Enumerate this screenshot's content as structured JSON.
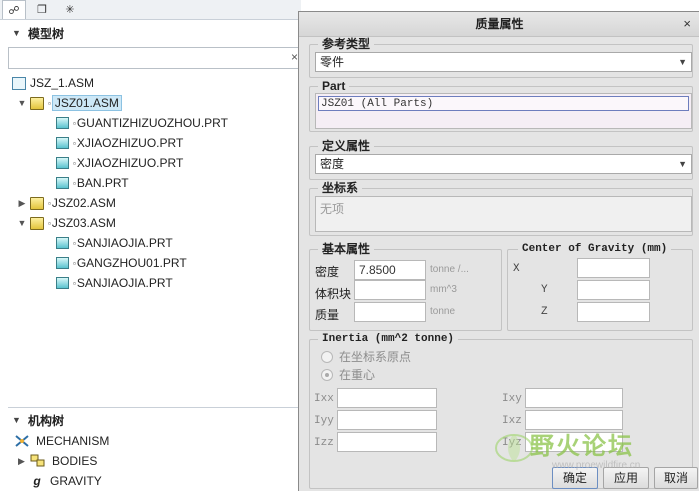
{
  "left_tabs": [
    "☍",
    "❐",
    "✳"
  ],
  "model_tree": {
    "header": "模型树",
    "search": {
      "value": "",
      "clear_glyph": "×"
    },
    "nodes": [
      {
        "label": "JSZ_1.ASM",
        "type": "top",
        "level": 0,
        "expand": ""
      },
      {
        "label": "JSZ01.ASM",
        "type": "asm",
        "level": 1,
        "expand": "▼",
        "selected": true
      },
      {
        "label": "GUANTIZHIZUOZHOU.PRT",
        "type": "prt",
        "level": 2,
        "expand": ""
      },
      {
        "label": "XJIAOZHIZUO.PRT",
        "type": "prt",
        "level": 2,
        "expand": ""
      },
      {
        "label": "XJIAOZHIZUO.PRT",
        "type": "prt",
        "level": 2,
        "expand": ""
      },
      {
        "label": "BAN.PRT",
        "type": "prt",
        "level": 2,
        "expand": ""
      },
      {
        "label": "JSZ02.ASM",
        "type": "asm",
        "level": 1,
        "expand": "▶"
      },
      {
        "label": "JSZ03.ASM",
        "type": "asm",
        "level": 1,
        "expand": "▼"
      },
      {
        "label": "SANJIAOJIA.PRT",
        "type": "prt",
        "level": 2,
        "expand": ""
      },
      {
        "label": "GANGZHOU01.PRT",
        "type": "prt",
        "level": 2,
        "expand": ""
      },
      {
        "label": "SANJIAOJIA.PRT",
        "type": "prt",
        "level": 2,
        "expand": ""
      }
    ]
  },
  "mechanism_tree": {
    "header": "机构树",
    "nodes": [
      {
        "label": "MECHANISM",
        "icon": "mechanism-icon"
      },
      {
        "label": "BODIES",
        "icon": "bodies-icon"
      },
      {
        "label": "GRAVITY",
        "icon": "gravity-icon"
      }
    ]
  },
  "dialog": {
    "title": "质量属性",
    "close_glyph": "×",
    "ref_type": {
      "label": "参考类型",
      "value": "零件"
    },
    "part": {
      "label": "Part",
      "value": "JSZ01 (All Parts)"
    },
    "define": {
      "label": "定义属性",
      "value": "密度"
    },
    "csys": {
      "label": "坐标系",
      "value": "无项"
    },
    "basic": {
      "label": "基本属性",
      "density_label": "密度",
      "density_value": "7.8500",
      "density_unit": "tonne /...",
      "volume_label": "体积块",
      "volume_value": "",
      "volume_unit": "mm^3",
      "mass_label": "质量",
      "mass_value": "",
      "mass_unit": "tonne"
    },
    "cog": {
      "label": "Center of Gravity (mm)",
      "x": "X",
      "y": "Y",
      "z": "Z"
    },
    "inertia": {
      "label": "Inertia (mm^2 tonne)",
      "opt_origin": "在坐标系原点",
      "opt_cog": "在重心",
      "ixx": "Ixx",
      "iyy": "Iyy",
      "izz": "Izz",
      "ixy": "Ixy",
      "ixz": "Ixz",
      "iyz": "Iyz"
    },
    "buttons": {
      "ok": "确定",
      "apply": "应用",
      "cancel": "取消"
    }
  },
  "watermark": {
    "text": "野火论坛",
    "url": "www.proewildfire.cn"
  },
  "colors": {
    "accent": "#cde8f7",
    "dialog_bg": "#e4e4e4",
    "watermark": "#8bc34a"
  }
}
